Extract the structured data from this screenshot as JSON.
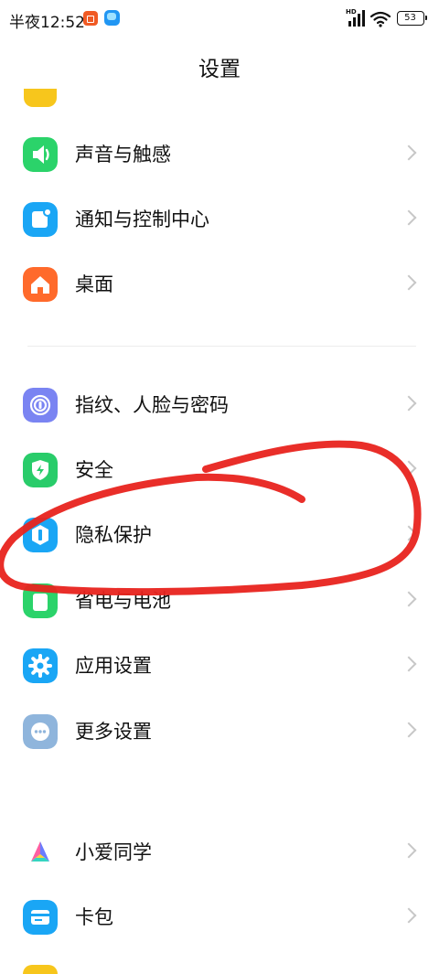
{
  "status_bar": {
    "time": "半夜12:52",
    "network_badge": "HD",
    "battery": "53"
  },
  "header": {
    "title": "设置"
  },
  "groups": [
    {
      "items": [
        {
          "label": "声音与触感",
          "icon": "speaker-icon",
          "color": "#2bd36a"
        },
        {
          "label": "通知与控制中心",
          "icon": "notification-icon",
          "color": "#1aa6f5"
        },
        {
          "label": "桌面",
          "icon": "home-icon",
          "color": "#ff6a2b"
        }
      ]
    },
    {
      "items": [
        {
          "label": "指纹、人脸与密码",
          "icon": "fingerprint-icon",
          "color": "#7a84f2"
        },
        {
          "label": "安全",
          "icon": "shield-icon",
          "color": "#29cc6a"
        },
        {
          "label": "隐私保护",
          "icon": "privacy-icon",
          "color": "#1aa6f5"
        },
        {
          "label": "省电与电池",
          "icon": "battery-icon",
          "color": "#2bd36a"
        },
        {
          "label": "应用设置",
          "icon": "gear-icon",
          "color": "#1aa6f5"
        },
        {
          "label": "更多设置",
          "icon": "more-icon",
          "color": "#8fb5dc"
        }
      ]
    },
    {
      "items": [
        {
          "label": "小爱同学",
          "icon": "xiaoai-icon",
          "color": "#ffffff"
        },
        {
          "label": "卡包",
          "icon": "wallet-icon",
          "color": "#1aa6f5"
        }
      ]
    }
  ],
  "annotation": {
    "stroke_color": "#e8231d"
  }
}
